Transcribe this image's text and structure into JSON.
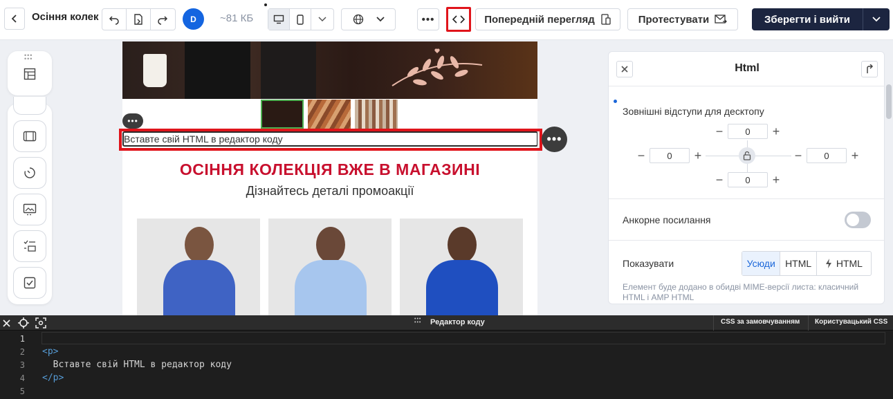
{
  "header": {
    "doc_title": "Осіння колекція",
    "avatar_letter": "D",
    "size_label": "~81 КБ",
    "preview_label": "Попередній перегляд",
    "test_label": "Протестувати",
    "save_label": "Зберегти і вийти",
    "code_button_icon": "code-brackets-icon"
  },
  "canvas": {
    "html_block_text": "Вставте свій HTML в редактор коду",
    "promo_title": "ОСІННЯ КОЛЕКЦІЯ ВЖЕ В МАГАЗИНІ",
    "promo_subtitle": "Дізнайтесь деталі промоакції"
  },
  "panel": {
    "title": "Html",
    "desktop_margins_label": "Зовнішні відступи для десктопу",
    "margins": {
      "top": "0",
      "left": "0",
      "right": "0",
      "bottom": "0"
    },
    "anchor_label": "Анкорне посилання",
    "anchor_enabled": false,
    "show_label": "Показувати",
    "show_options": [
      "Усюди",
      "HTML",
      "HTML"
    ],
    "show_selected": "Усюди",
    "hint": "Елемент буде додано в обидві MIME-версії листа: класичний HTML і AMP HTML"
  },
  "editor": {
    "title": "Редактор коду",
    "tab_default_css": "CSS за замовчуванням",
    "tab_custom_css": "Користувацький CSS",
    "line_numbers": [
      "1",
      "2",
      "3",
      "4",
      "5"
    ],
    "lines": {
      "l2": "<p>",
      "l3": "  Вставте свій HTML в редактор коду",
      "l4": "</p>"
    }
  },
  "colors": {
    "accent_red": "#e0141b",
    "promo_red": "#c8102e",
    "save_bg": "#1c2540",
    "avatar_blue": "#1465e0"
  }
}
